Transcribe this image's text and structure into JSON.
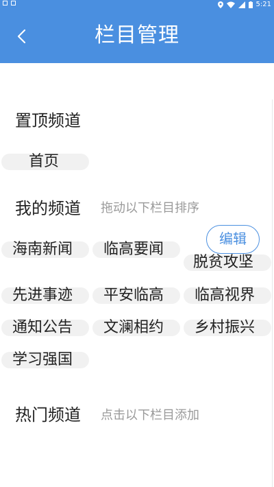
{
  "status_bar": {
    "time": "5:21"
  },
  "header": {
    "title": "栏目管理"
  },
  "pinned": {
    "title": "置顶频道",
    "items": [
      "首页"
    ]
  },
  "mine": {
    "title": "我的频道",
    "hint": "拖动以下栏目排序",
    "edit_label": "编辑",
    "items": [
      "海南新闻",
      "临高要闻",
      "脱贫攻坚",
      "先进事迹",
      "平安临高",
      "临高视界",
      "通知公告",
      "文澜相约",
      "乡村振兴",
      "学习强国"
    ]
  },
  "hot": {
    "title": "热门频道",
    "hint": "点击以下栏目添加"
  },
  "colors": {
    "accent": "#4a8fe0",
    "chip_bg": "#f1f1f1"
  }
}
